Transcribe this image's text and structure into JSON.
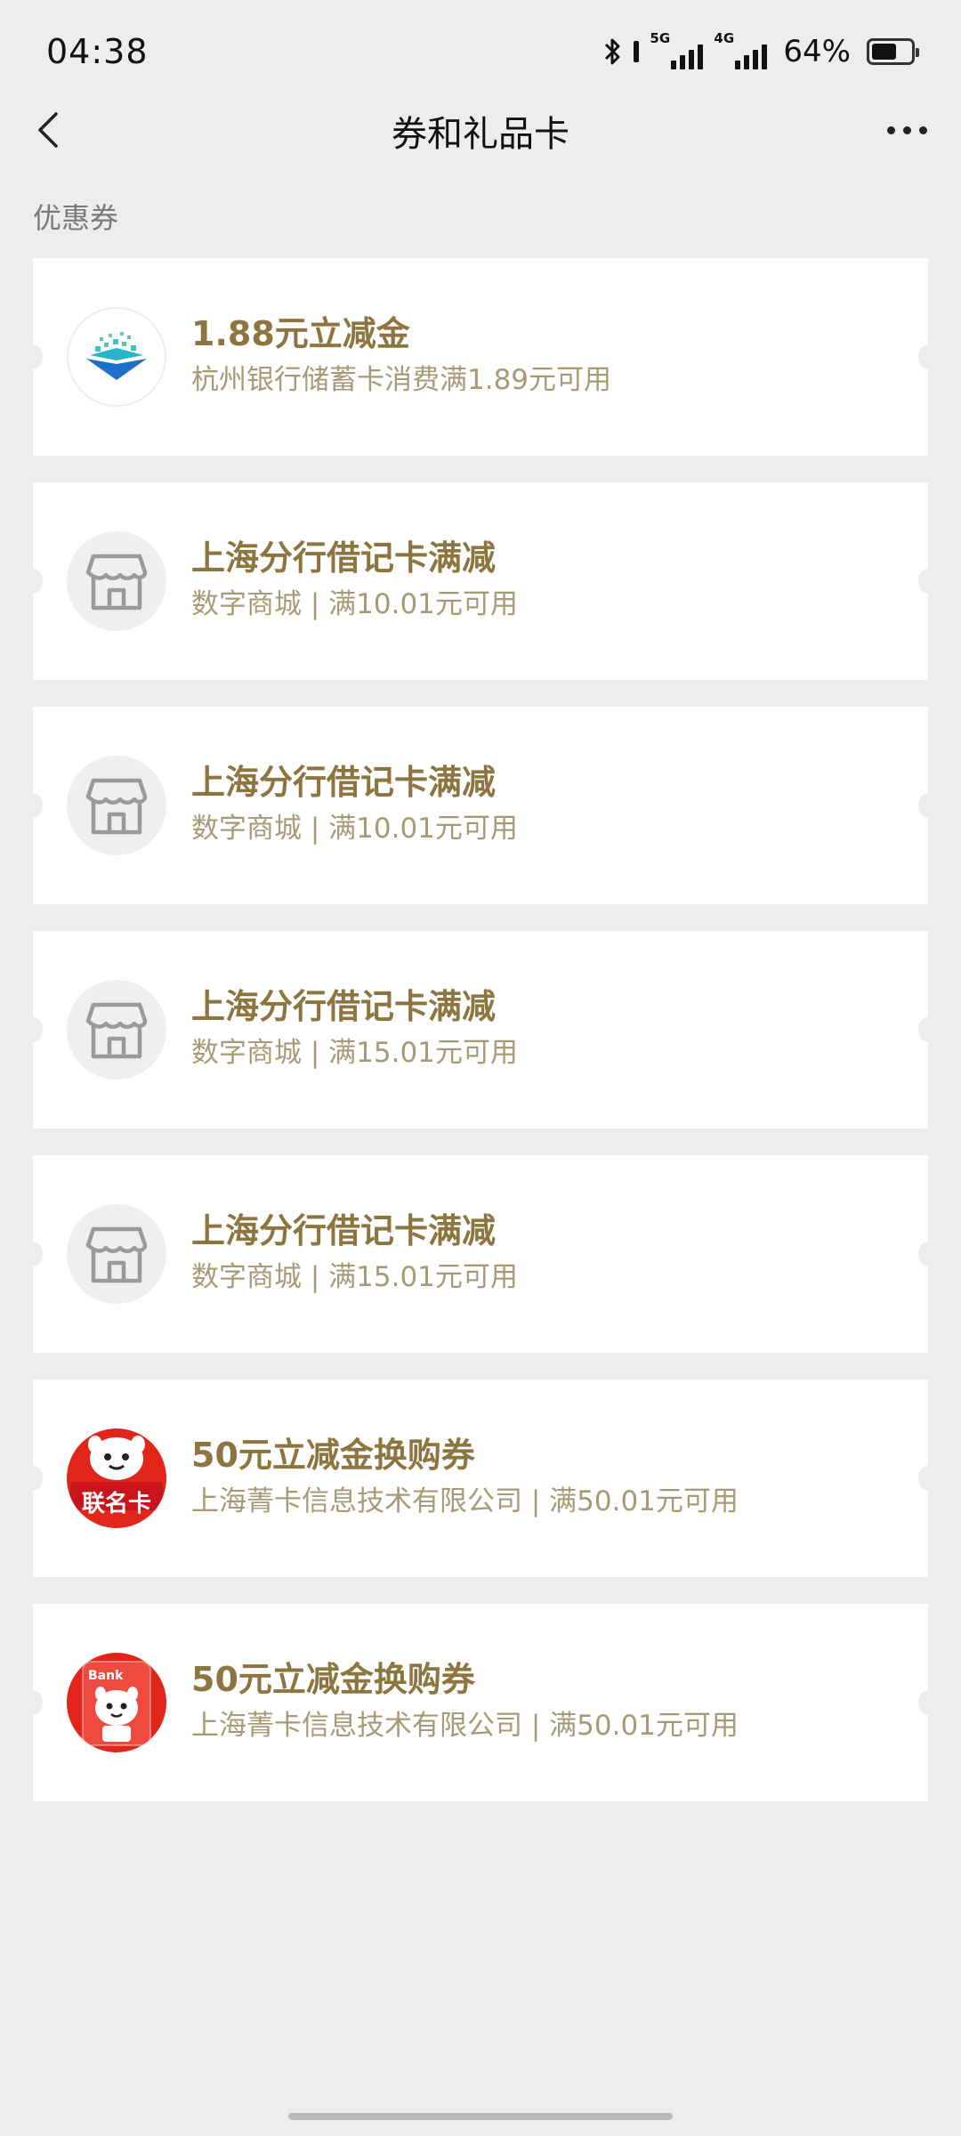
{
  "status_bar": {
    "time": "04:38",
    "signal1_label": "5G",
    "signal2_label": "4G",
    "battery_percent": "64%",
    "battery_level": 0.64
  },
  "nav": {
    "title": "券和礼品卡"
  },
  "section_label": "优惠券",
  "coupons": [
    {
      "icon": "bank-logo-icon",
      "title": "1.88元立减金",
      "desc": "杭州银行储蓄卡消费满1.89元可用"
    },
    {
      "icon": "store-icon",
      "title": "上海分行借记卡满减",
      "desc": "数字商城 | 满10.01元可用"
    },
    {
      "icon": "store-icon",
      "title": "上海分行借记卡满减",
      "desc": "数字商城 | 满10.01元可用"
    },
    {
      "icon": "store-icon",
      "title": "上海分行借记卡满减",
      "desc": "数字商城 | 满15.01元可用"
    },
    {
      "icon": "store-icon",
      "title": "上海分行借记卡满减",
      "desc": "数字商城 | 满15.01元可用"
    },
    {
      "icon": "jd-cobrand-card-icon",
      "icon_text": "联名卡",
      "title": "50元立减金换购券",
      "desc": "上海菁卡信息技术有限公司 | 满50.01元可用"
    },
    {
      "icon": "jd-bank-card-icon",
      "icon_text": "Bank",
      "title": "50元立减金换购券",
      "desc": "上海菁卡信息技术有限公司 | 满50.01元可用"
    }
  ],
  "colors": {
    "page_bg": "#ededed",
    "title_gold": "#8d7540",
    "desc_gold": "#a89a76",
    "jd_red": "#e1251b"
  }
}
